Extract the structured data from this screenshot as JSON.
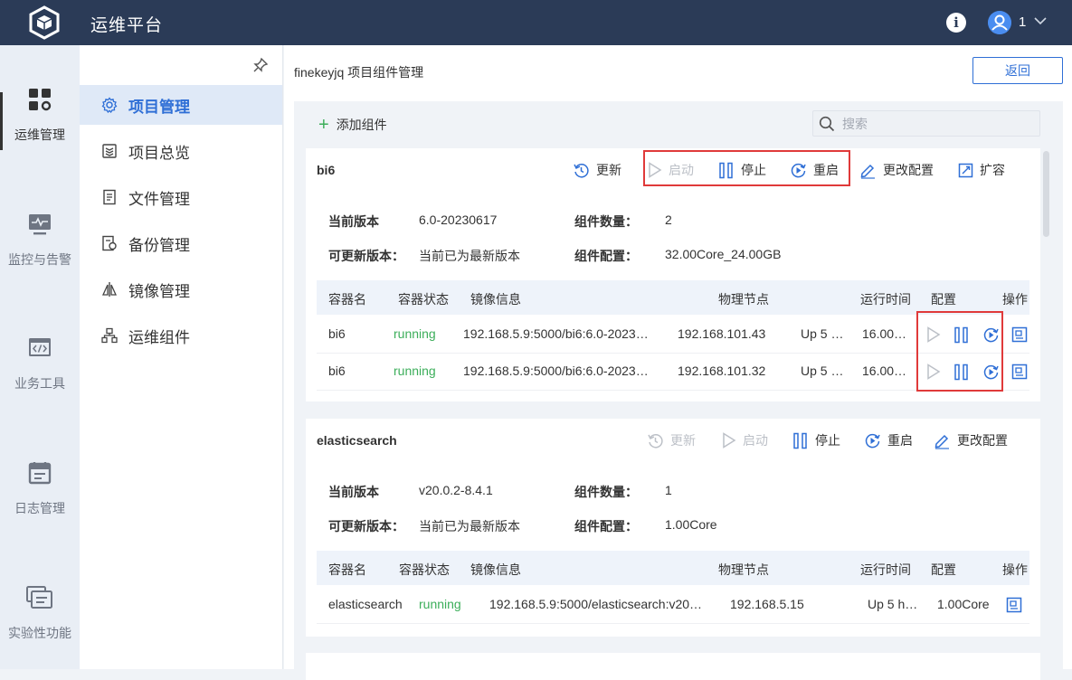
{
  "app": {
    "title": "运维平台",
    "user": "1"
  },
  "leftnav": [
    {
      "label": "运维管理",
      "icon": "grid-gear-icon",
      "active": true
    },
    {
      "label": "监控与告警",
      "icon": "monitor-pulse-icon"
    },
    {
      "label": "业务工具",
      "icon": "code-window-icon"
    },
    {
      "label": "日志管理",
      "icon": "calendar-log-icon"
    },
    {
      "label": "实验性功能",
      "icon": "layers-window-icon"
    }
  ],
  "subnav": [
    {
      "label": "项目管理",
      "icon": "gear-icon",
      "active": true
    },
    {
      "label": "项目总览",
      "icon": "stack-icon"
    },
    {
      "label": "文件管理",
      "icon": "file-icon"
    },
    {
      "label": "备份管理",
      "icon": "backup-icon"
    },
    {
      "label": "镜像管理",
      "icon": "mirror-icon"
    },
    {
      "label": "运维组件",
      "icon": "network-icon"
    }
  ],
  "breadcrumb": "finekeyjq 项目组件管理",
  "back_label": "返回",
  "add_label": "添加组件",
  "search_placeholder": "搜索",
  "labels": {
    "current_version": "当前版本",
    "updatable_version": "可更新版本：",
    "component_count": "组件数量：",
    "component_config": "组件配置：",
    "update": "更新",
    "start": "启动",
    "stop": "停止",
    "restart": "重启",
    "change_config": "更改配置",
    "scale": "扩容"
  },
  "table_headers": {
    "name": "容器名",
    "status": "容器状态",
    "image": "镜像信息",
    "node": "物理节点",
    "uptime": "运行时间",
    "config": "配置",
    "ops": "操作"
  },
  "components": [
    {
      "name": "bi6",
      "current_version": "6.0-20230617",
      "updatable": "当前已为最新版本",
      "count": "2",
      "config": "32.00Core_24.00GB",
      "rows": [
        {
          "name": "bi6",
          "status": "running",
          "image": "192.168.5.9:5000/bi6:6.0-2023…",
          "node": "192.168.101.43",
          "uptime": "Up 5 …",
          "config": "16.00…"
        },
        {
          "name": "bi6",
          "status": "running",
          "image": "192.168.5.9:5000/bi6:6.0-2023…",
          "node": "192.168.101.32",
          "uptime": "Up 5 …",
          "config": "16.00…"
        }
      ]
    },
    {
      "name": "elasticsearch",
      "current_version": "v20.0.2-8.4.1",
      "updatable": "当前已为最新版本",
      "count": "1",
      "config": "1.00Core",
      "rows": [
        {
          "name": "elasticsearch",
          "status": "running",
          "image": "192.168.5.9:5000/elasticsearch:v20…",
          "node": "192.168.5.15",
          "uptime": "Up 5 h…",
          "config": "1.00Core"
        }
      ]
    }
  ],
  "colors": {
    "topbar": "#2b3b57",
    "accent": "#2f6fd6",
    "running": "#3cae5a",
    "highlight": "#e03a3a"
  }
}
